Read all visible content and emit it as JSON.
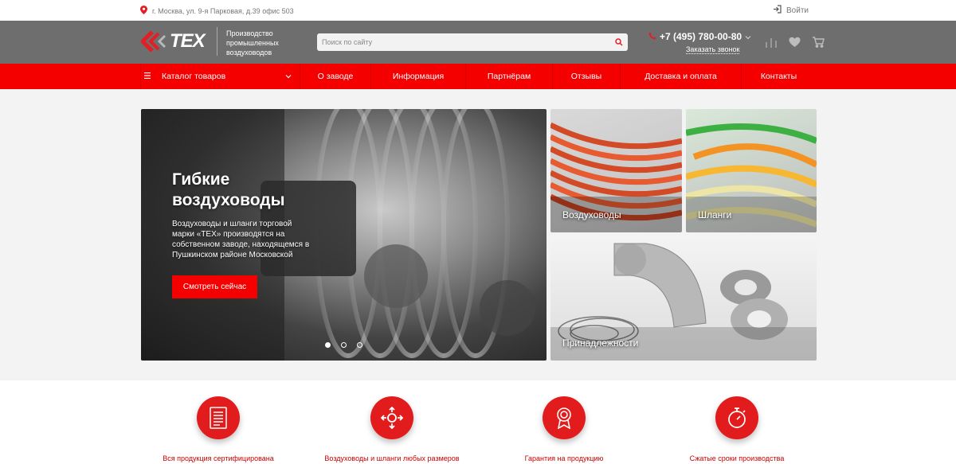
{
  "topbar": {
    "address": "г. Москва, ул. 9-я Парковая, д.39 офис 503",
    "login": "Войти"
  },
  "header": {
    "logo_text": "TEX",
    "tagline": "Производство промышленных воздуховодов",
    "search_placeholder": "Поиск по сайту",
    "phone": "+7 (495) 780-00-80",
    "callback": "Заказать звонок"
  },
  "nav": {
    "catalog": "Каталог товаров",
    "items": [
      "О заводе",
      "Информация",
      "Партнёрам",
      "Отзывы",
      "Доставка и оплата",
      "Контакты"
    ]
  },
  "banner": {
    "title": "Гибкие воздуховоды",
    "text": "Воздуховоды и шланги торговой марки «ТЕХ» производятся на собственном заводе, находящемся в Пушкинском районе Московской",
    "button": "Смотреть сейчас",
    "slides": 3,
    "active_slide": 1
  },
  "tiles": {
    "ducts": "Воздуховоды",
    "hoses": "Шланги",
    "accessories": "Принадлежности"
  },
  "features": [
    {
      "label": "Вся продукция сертифицирована",
      "icon": "certificate-icon"
    },
    {
      "label": "Воздуховоды и шланги любых размеров",
      "icon": "arrows-expand-icon"
    },
    {
      "label": "Гарантия на продукцию",
      "icon": "award-badge-icon"
    },
    {
      "label": "Сжатые сроки производства",
      "icon": "stopwatch-icon"
    }
  ],
  "colors": {
    "accent": "#f50000",
    "header": "#6e6e6e"
  }
}
